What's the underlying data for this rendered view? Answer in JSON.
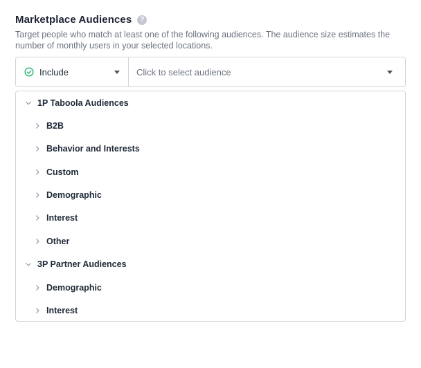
{
  "section": {
    "title": "Marketplace Audiences",
    "help_icon": "?",
    "description": "Target people who match at least one of the following audiences. The audience size estimates the number of monthly users in your selected locations."
  },
  "selector": {
    "mode_label": "Include",
    "audience_placeholder": "Click to select audience"
  },
  "tree": {
    "groups": [
      {
        "label": "1P Taboola Audiences",
        "children": [
          "B2B",
          "Behavior and Interests",
          "Custom",
          "Demographic",
          "Interest",
          "Other"
        ]
      },
      {
        "label": "3P Partner Audiences",
        "children": [
          "Demographic",
          "Interest"
        ]
      }
    ]
  },
  "colors": {
    "check_green": "#22b573",
    "border": "#cfd4db",
    "muted_text": "#6b7280"
  }
}
